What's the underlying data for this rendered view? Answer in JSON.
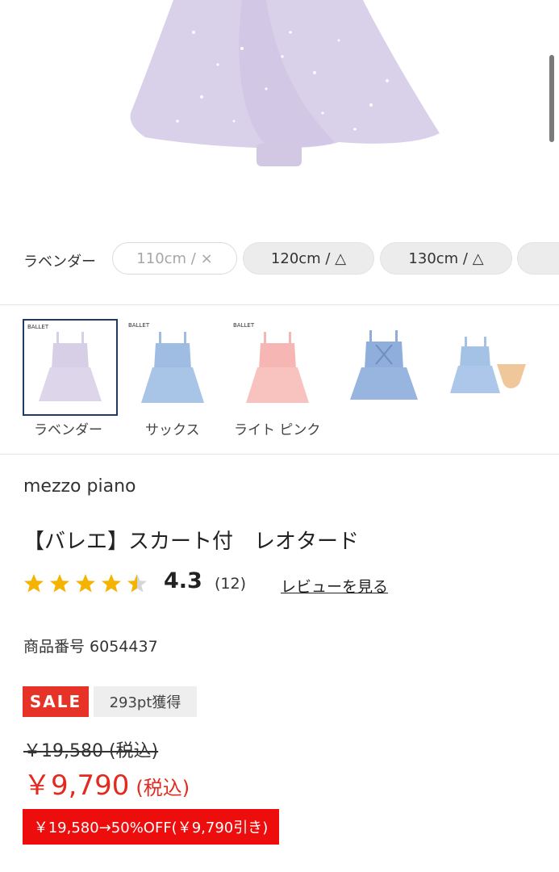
{
  "product_image": {
    "alt": "lavender leotard with glitter skirt"
  },
  "size_selector": {
    "color_label": "ラベンダー",
    "sizes": [
      {
        "label": "110cm / ×",
        "state": "unavailable"
      },
      {
        "label": "120cm / △",
        "state": "limited"
      },
      {
        "label": "130cm / △",
        "state": "limited"
      }
    ]
  },
  "color_variants": [
    {
      "label": "ラベンダー",
      "color": "#d7cfe6",
      "selected": true
    },
    {
      "label": "サックス",
      "color": "#9fbde2",
      "selected": false
    },
    {
      "label": "ライト ピンク",
      "color": "#f6b7b4",
      "selected": false
    },
    {
      "label": "",
      "color": "#8faedb",
      "selected": false
    },
    {
      "label": "",
      "color": "#a4c1e6",
      "selected": false
    }
  ],
  "product": {
    "brand": "mezzo piano",
    "title": "【バレエ】スカート付　レオタード",
    "rating": "4.3",
    "rating_value": 4.3,
    "review_count": "(12)",
    "review_link": "レビューを見る",
    "product_number": "商品番号 6054437"
  },
  "pricing": {
    "sale_badge": "SALE",
    "points": "293pt獲得",
    "original_price": "￥19,580 (税込)",
    "sale_price": "￥9,790",
    "tax_note": "(税込)",
    "discount_note": "￥19,580→50%OFF(￥9,790引き)"
  },
  "colors": {
    "sale_red": "#e63227",
    "price_red": "#e32a1e",
    "star": "#f5b301",
    "selected_border": "#1f3b63"
  }
}
